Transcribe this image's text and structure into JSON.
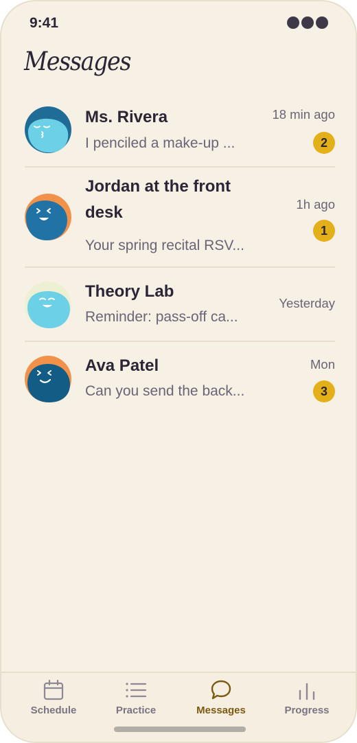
{
  "status": {
    "time": "9:41"
  },
  "page": {
    "title": "Messages"
  },
  "threads": [
    {
      "name": "Ms. Rivera",
      "preview": "I penciled a make-up ...",
      "time": "18 min ago",
      "unread": "2",
      "avatar": "avatar-rivera"
    },
    {
      "name": "Jordan at the front desk",
      "preview": "Your spring recital RSV...",
      "time": "1h ago",
      "unread": "1",
      "avatar": "avatar-jordan"
    },
    {
      "name": "Theory Lab",
      "preview": "Reminder: pass-off ca...",
      "time": "Yesterday",
      "unread": "",
      "avatar": "avatar-theory-lab"
    },
    {
      "name": "Ava Patel",
      "preview": "Can you send the back...",
      "time": "Mon",
      "unread": "3",
      "avatar": "avatar-ava"
    }
  ],
  "tabs": [
    {
      "label": "Schedule",
      "icon": "calendar-icon",
      "active": false
    },
    {
      "label": "Practice",
      "icon": "list-icon",
      "active": false
    },
    {
      "label": "Messages",
      "icon": "chat-bubble-icon",
      "active": true
    },
    {
      "label": "Progress",
      "icon": "bar-chart-icon",
      "active": false
    }
  ],
  "colors": {
    "background": "#f7f0e4",
    "accent": "#7a5a10",
    "badge": "#e4b01a",
    "text": "#2b2536",
    "muted": "#6b6476"
  }
}
